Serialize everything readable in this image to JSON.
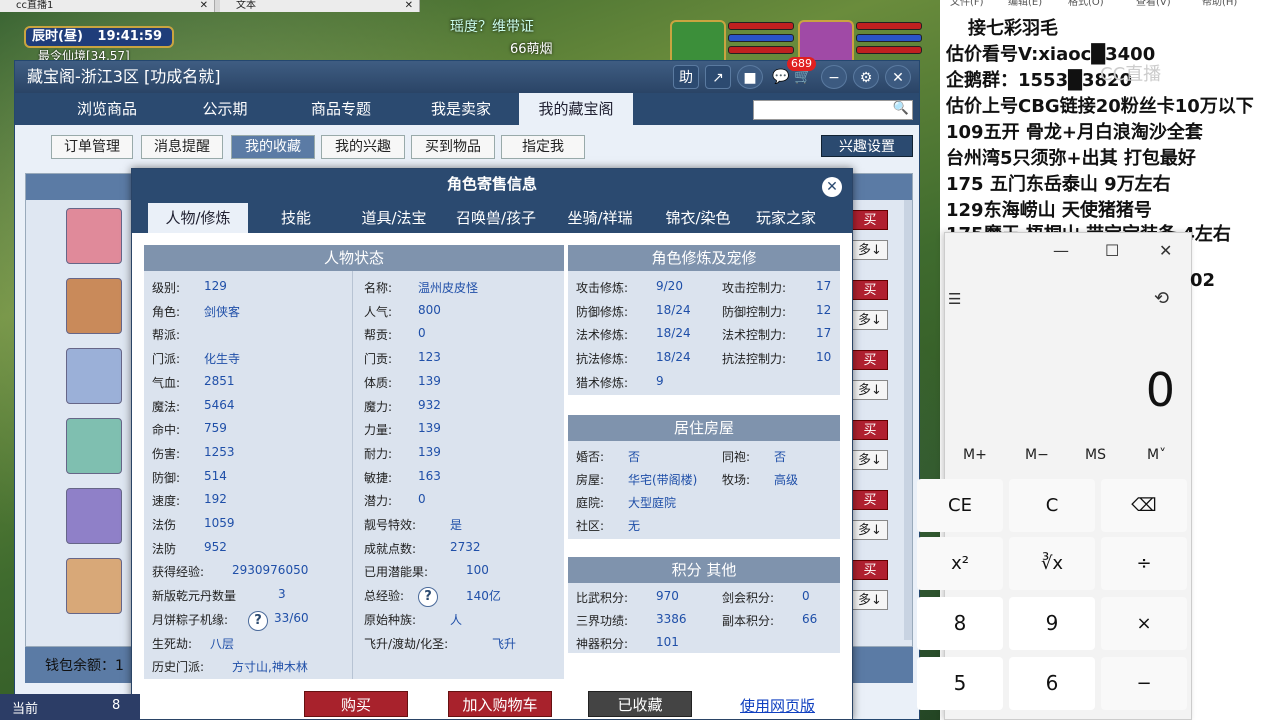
{
  "browser_tabs": [
    "cc直播1",
    "文本"
  ],
  "game": {
    "clock_label": "辰时(昼)",
    "clock_time": "19:41:59",
    "zone_label": "最令仙境[34,57]",
    "banner_text": "瑶度？维带证",
    "banner_text2": "66萌烟"
  },
  "store": {
    "title": "藏宝阁-浙江3区 [功成名就]",
    "title_icons": [
      "助",
      "↗",
      "■"
    ],
    "cart_badge": "689",
    "nav": [
      "浏览商品",
      "公示期",
      "商品专题",
      "我是卖家",
      "我的藏宝阁"
    ],
    "subnav": [
      "订单管理",
      "消息提醒",
      "我的收藏",
      "我的兴趣",
      "买到物品",
      "指定我"
    ],
    "interest_settings": "兴趣设置",
    "buy_tags": [
      "买",
      "买",
      "买",
      "买",
      "买",
      "买"
    ],
    "more_tags": [
      "多↓",
      "多↓",
      "多↓",
      "多↓",
      "多↓",
      "多↓"
    ],
    "wallet_label": "钱包余额：1"
  },
  "modal": {
    "title": "角色寄售信息",
    "tabs": [
      "人物/修炼",
      "技能",
      "道具/法宝",
      "召唤兽/孩子",
      "坐骑/祥瑞",
      "锦衣/染色",
      "玩家之家"
    ],
    "status": {
      "header": "人物状态",
      "left": [
        {
          "label": "级别:",
          "value": "129"
        },
        {
          "label": "角色:",
          "value": "剑侠客"
        },
        {
          "label": "帮派:",
          "value": ""
        },
        {
          "label": "门派:",
          "value": "化生寺"
        },
        {
          "label": "气血:",
          "value": "2851"
        },
        {
          "label": "魔法:",
          "value": "5464"
        },
        {
          "label": "命中:",
          "value": "759"
        },
        {
          "label": "伤害:",
          "value": "1253"
        },
        {
          "label": "防御:",
          "value": "514"
        },
        {
          "label": "速度:",
          "value": "192"
        },
        {
          "label": "法伤",
          "value": "1059"
        },
        {
          "label": "法防",
          "value": "952"
        },
        {
          "label": "获得经验:",
          "value": "2930976050"
        },
        {
          "label": "新版乾元丹数量",
          "value": "3"
        },
        {
          "label": "月饼粽子机缘:",
          "value": "33/60"
        },
        {
          "label": "生死劫:",
          "value": "八层"
        },
        {
          "label": "历史门派:",
          "value": "方寸山,神木林"
        }
      ],
      "right": [
        {
          "label": "名称:",
          "value": "温州皮皮怪"
        },
        {
          "label": "人气:",
          "value": "800"
        },
        {
          "label": "帮贡:",
          "value": "0"
        },
        {
          "label": "门贡:",
          "value": "123"
        },
        {
          "label": "体质:",
          "value": "139"
        },
        {
          "label": "魔力:",
          "value": "932"
        },
        {
          "label": "力量:",
          "value": "139"
        },
        {
          "label": "耐力:",
          "value": "139"
        },
        {
          "label": "敏捷:",
          "value": "163"
        },
        {
          "label": "潜力:",
          "value": "0"
        },
        {
          "label": "靓号特效:",
          "value": "是"
        },
        {
          "label": "成就点数:",
          "value": "2732"
        },
        {
          "label": "已用潜能果:",
          "value": "100"
        },
        {
          "label": "总经验:",
          "value": "140亿"
        },
        {
          "label": "原始种族:",
          "value": "人"
        },
        {
          "label": "飞升/渡劫/化圣:",
          "value": "飞升"
        }
      ]
    },
    "cultivation": {
      "header": "角色修炼及宠修",
      "left": [
        {
          "label": "攻击修炼:",
          "value": "9/20"
        },
        {
          "label": "防御修炼:",
          "value": "18/24"
        },
        {
          "label": "法术修炼:",
          "value": "18/24"
        },
        {
          "label": "抗法修炼:",
          "value": "18/24"
        },
        {
          "label": "猎术修炼:",
          "value": "9"
        }
      ],
      "right": [
        {
          "label": "攻击控制力:",
          "value": "17"
        },
        {
          "label": "防御控制力:",
          "value": "12"
        },
        {
          "label": "法术控制力:",
          "value": "17"
        },
        {
          "label": "抗法控制力:",
          "value": "10"
        }
      ]
    },
    "housing": {
      "header": "居住房屋",
      "rows": [
        {
          "label": "婚否:",
          "value": "否",
          "label2": "同袍:",
          "value2": "否"
        },
        {
          "label": "房屋:",
          "value": "华宅(带阁楼)",
          "label2": "牧场:",
          "value2": "高级"
        },
        {
          "label": "庭院:",
          "value": "大型庭院"
        },
        {
          "label": "社区:",
          "value": "无"
        }
      ]
    },
    "points": {
      "header": "积分 其他",
      "rows": [
        {
          "label": "比武积分:",
          "value": "970",
          "label2": "剑会积分:",
          "value2": "0"
        },
        {
          "label": "三界功绩:",
          "value": "3386",
          "label2": "副本积分:",
          "value2": "66"
        },
        {
          "label": "神器积分:",
          "value": "101"
        }
      ]
    },
    "buttons": {
      "buy": "购买",
      "cart": "加入购物车",
      "saved": "已收藏",
      "web": "使用网页版"
    }
  },
  "overlay": {
    "menu": [
      "文件(F)",
      "编辑(E)",
      "格式(O)",
      "查看(V)",
      "帮助(H)"
    ],
    "lines": [
      "接七彩羽毛",
      "估价看号V:xiaoc█3400",
      "企鹅群：1553█3820",
      "估价上号CBG链接20粉丝卡10万以下",
      "109五开 骨龙+月白浪淘沙全套",
      "台州湾5只须弥+出其 打包最好",
      "175 五门东岳泰山  9万左右",
      "129东海崂山 天使猪猪号",
      "175魔王 梧桐山  带宝宝装备 4左右"
    ],
    "watermark": "CC直播",
    "fragment": "02"
  },
  "calculator": {
    "window_buttons": [
      "—",
      "☐",
      "✕"
    ],
    "display": "0",
    "memory": [
      "M+",
      "M−",
      "MS",
      "M˅"
    ],
    "keys": [
      [
        "CE",
        "C",
        "⌫"
      ],
      [
        "x²",
        "∛x",
        "÷"
      ],
      [
        "8",
        "9",
        "×"
      ],
      [
        "5",
        "6",
        "−"
      ]
    ]
  },
  "bottom_bar": {
    "current": "当前",
    "num": "8"
  }
}
